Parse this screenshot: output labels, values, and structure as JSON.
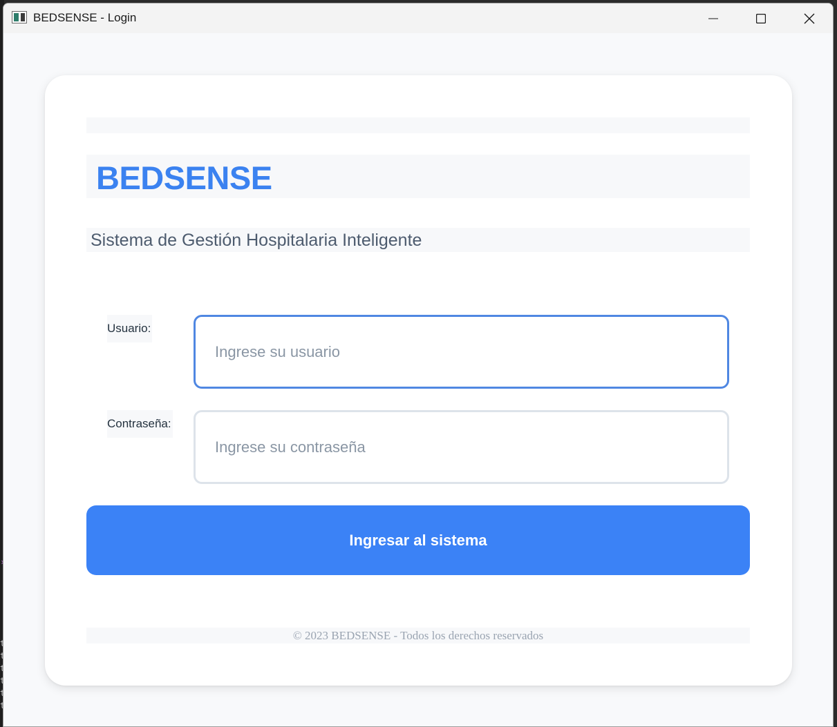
{
  "window": {
    "title": "BEDSENSE - Login",
    "icon": "app-window-icon",
    "controls": {
      "minimize_icon": "minimize-icon",
      "maximize_icon": "maximize-icon",
      "close_icon": "close-icon"
    }
  },
  "login": {
    "brand": "BEDSENSE",
    "subtitle": "Sistema de Gestión Hospitalaria Inteligente",
    "username": {
      "label": "Usuario:",
      "value": "",
      "placeholder": "Ingrese su usuario"
    },
    "password": {
      "label": "Contraseña:",
      "value": "",
      "placeholder": "Ingrese su contraseña"
    },
    "submit_label": "Ingresar al sistema",
    "footer": "© 2023 BEDSENSE - Todos los derechos reservados"
  },
  "colors": {
    "brand": "#3b82f0",
    "button": "#3b82f6",
    "focused_border": "#4f87e2",
    "background": "#f8f9fb"
  },
  "backdrop": {
    "glyphs": [
      "›",
      "t",
      "t",
      "t",
      "t",
      "t",
      "t"
    ]
  }
}
